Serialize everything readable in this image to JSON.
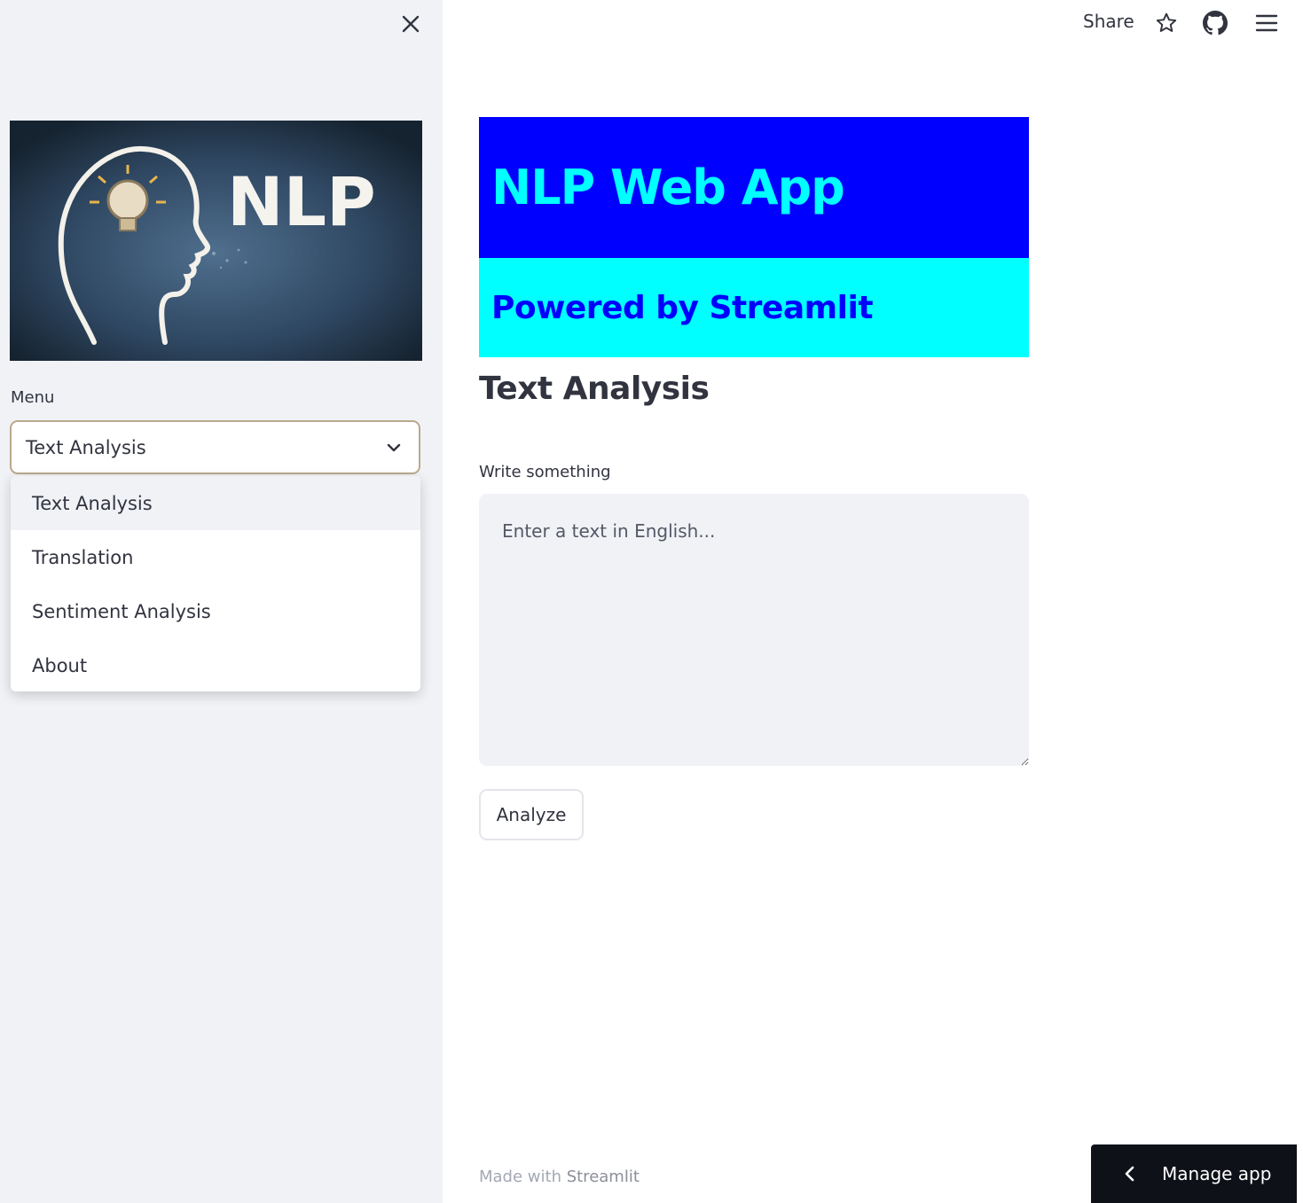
{
  "sidebar": {
    "image_caption": "NLP",
    "menu_label": "Menu",
    "select_value": "Text Analysis",
    "options": [
      "Text Analysis",
      "Translation",
      "Sentiment Analysis",
      "About"
    ]
  },
  "topbar": {
    "share_label": "Share"
  },
  "main": {
    "title": "NLP Web App",
    "subtitle": "Powered by Streamlit",
    "section_title": "Text Analysis",
    "input_label": "Write something",
    "input_placeholder": "Enter a text in English...",
    "button_label": "Analyze"
  },
  "footer": {
    "prefix": "Made with ",
    "brand": "Streamlit"
  },
  "manage_app": {
    "label": "Manage app"
  },
  "colors": {
    "title_bg": "#0000ff",
    "title_text": "#00ffff",
    "subtitle_bg": "#00ffff",
    "subtitle_text": "#0000ff",
    "sidebar_bg": "#f0f2f6"
  },
  "icons": [
    "close-icon",
    "chevron-down-icon",
    "star-icon",
    "github-icon",
    "hamburger-menu-icon",
    "chevron-left-icon",
    "lightbulb-head-icon"
  ]
}
